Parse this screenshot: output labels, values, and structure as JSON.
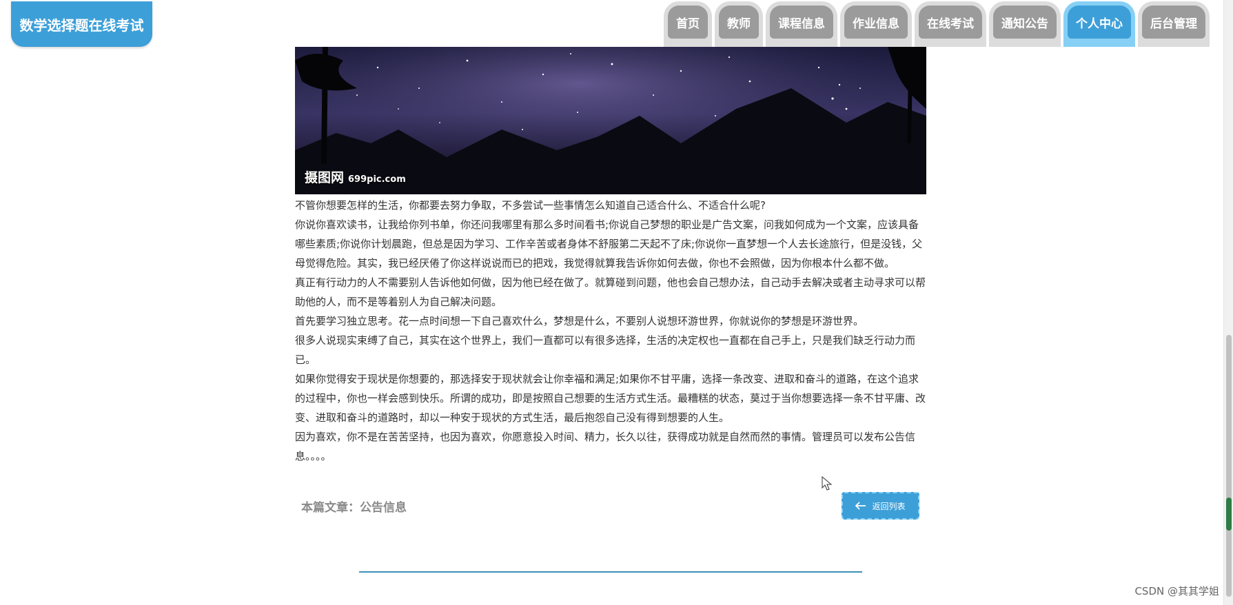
{
  "brand": {
    "title": "数学选择题在线考试"
  },
  "nav": {
    "items": [
      {
        "label": "首页",
        "active": false
      },
      {
        "label": "教师",
        "active": false
      },
      {
        "label": "课程信息",
        "active": false
      },
      {
        "label": "作业信息",
        "active": false
      },
      {
        "label": "在线考试",
        "active": false
      },
      {
        "label": "通知公告",
        "active": false
      },
      {
        "label": "个人中心",
        "active": true
      },
      {
        "label": "后台管理",
        "active": false
      }
    ]
  },
  "banner": {
    "watermark_main": "摄图网",
    "watermark_site": "699pic.com"
  },
  "article": {
    "paragraphs": [
      "不管你想要怎样的生活，你都要去努力争取，不多尝试一些事情怎么知道自己适合什么、不适合什么呢?",
      "你说你喜欢读书，让我给你列书单，你还问我哪里有那么多时间看书;你说自己梦想的职业是广告文案，问我如何成为一个文案，应该具备哪些素质;你说你计划晨跑，但总是因为学习、工作辛苦或者身体不舒服第二天起不了床;你说你一直梦想一个人去长途旅行，但是没钱，父母觉得危险。其实，我已经厌倦了你这样说说而已的把戏，我觉得就算我告诉你如何去做，你也不会照做，因为你根本什么都不做。",
      "真正有行动力的人不需要别人告诉他如何做，因为他已经在做了。就算碰到问题，他也会自己想办法，自己动手去解决或者主动寻求可以帮助他的人，而不是等着别人为自己解决问题。",
      "首先要学习独立思考。花一点时间想一下自己喜欢什么，梦想是什么，不要别人说想环游世界，你就说你的梦想是环游世界。",
      "很多人说现实束缚了自己，其实在这个世界上，我们一直都可以有很多选择，生活的决定权也一直都在自己手上，只是我们缺乏行动力而已。",
      "如果你觉得安于现状是你想要的，那选择安于现状就会让你幸福和满足;如果你不甘平庸，选择一条改变、进取和奋斗的道路，在这个追求的过程中，你也一样会感到快乐。所谓的成功，即是按照自己想要的生活方式生活。最糟糕的状态，莫过于当你想要选择一条不甘平庸、改变、进取和奋斗的道路时，却以一种安于现状的方式生活，最后抱怨自己没有得到想要的人生。",
      "因为喜欢，你不是在苦苦坚持，也因为喜欢，你愿意投入时间、精力，长久以往，获得成功就是自然而然的事情。管理员可以发布公告信息。。。。"
    ]
  },
  "footer": {
    "category_label": "本篇文章：公告信息",
    "back_label": "返回列表"
  },
  "watermark": {
    "text": "CSDN @其其学姐"
  },
  "colors": {
    "accent": "#3d9fd8",
    "nav_inactive": "#9b9b9b",
    "nav_active_outer": "#86d0f5"
  }
}
